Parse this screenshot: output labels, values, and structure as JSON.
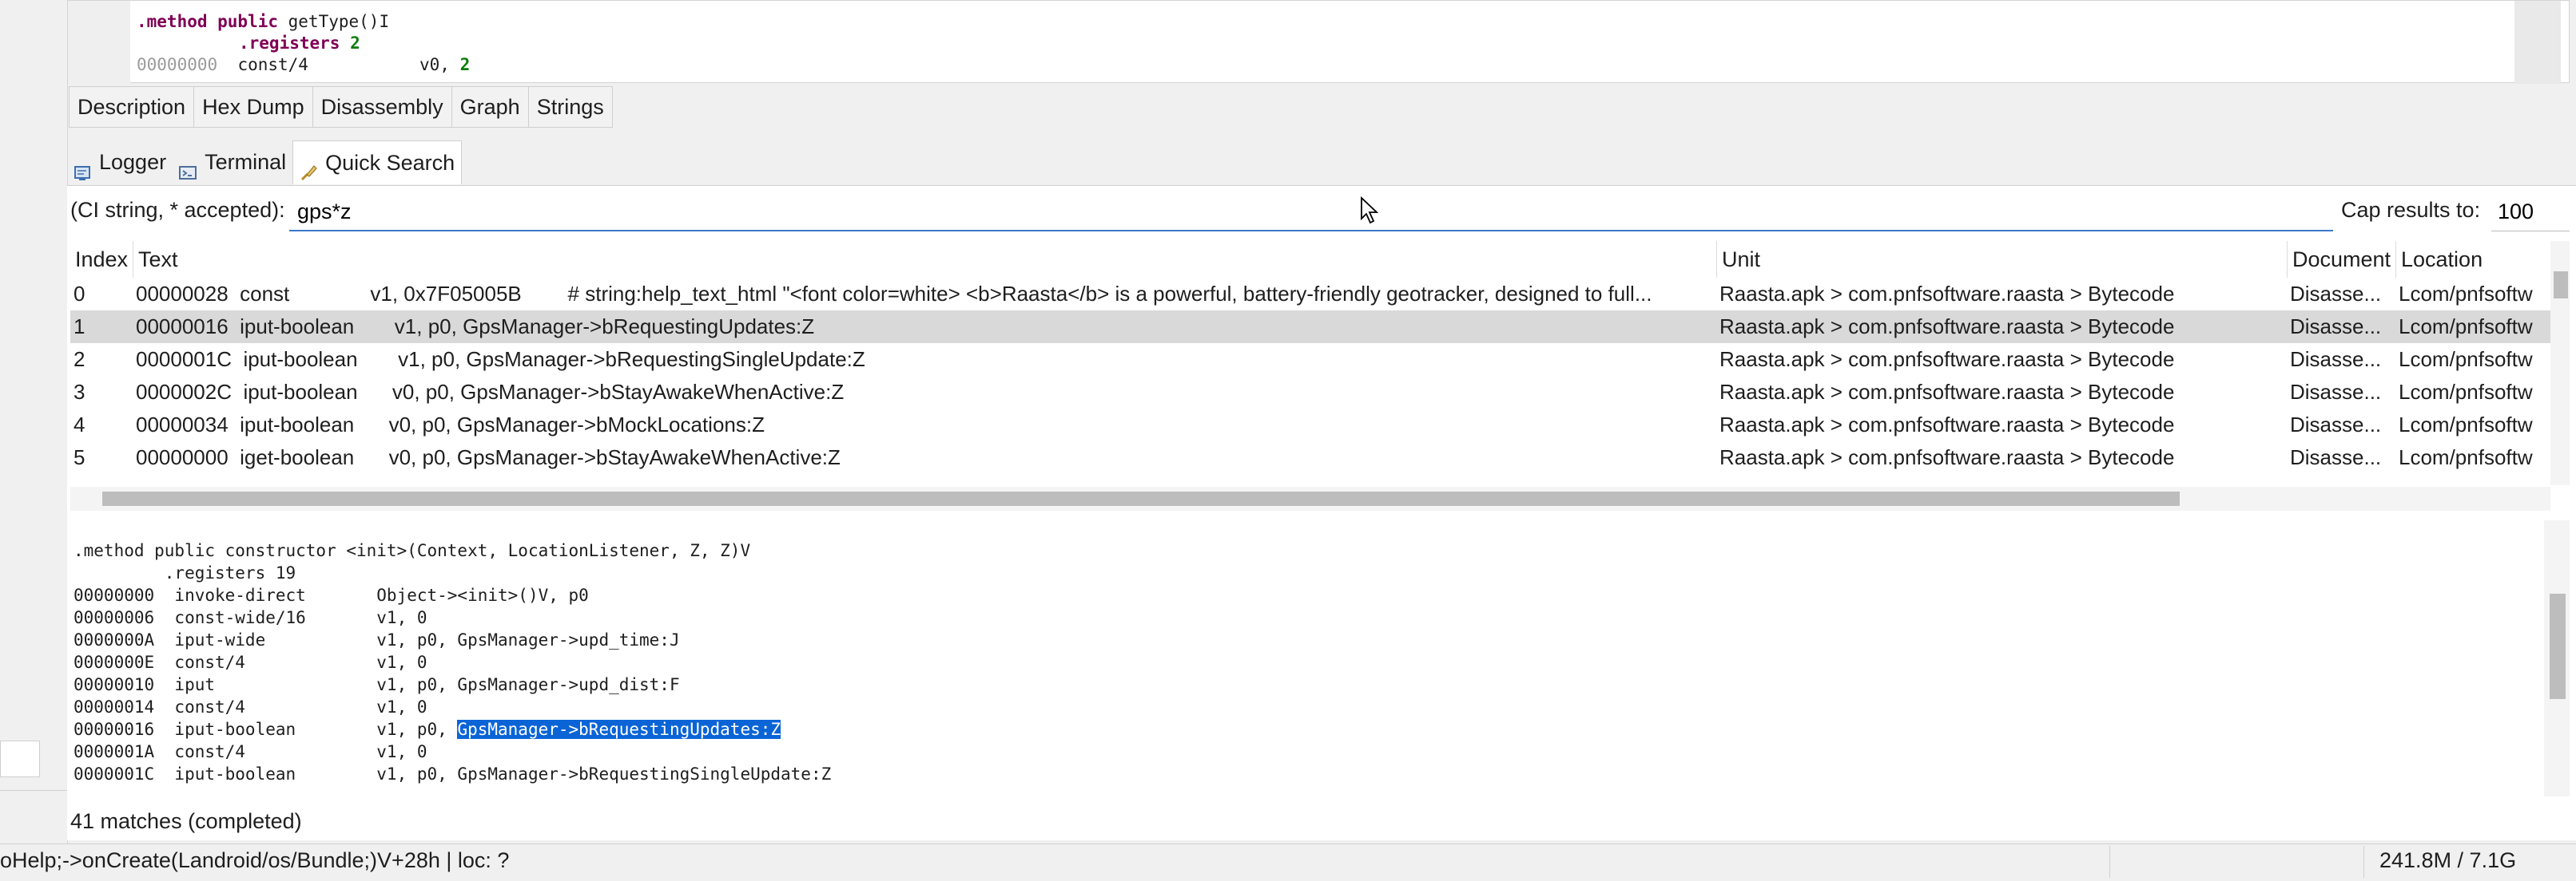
{
  "top_code": {
    "line1_kw": ".method public ",
    "line1_rest": "getType()I",
    "line2_kw": ".registers",
    "line2_num": " 2",
    "line3_addr": "00000000",
    "line3_instr": "  const/4           v0, ",
    "line3_num": "2"
  },
  "view_tabs": [
    "Description",
    "Hex Dump",
    "Disassembly",
    "Graph",
    "Strings"
  ],
  "panel_tabs": [
    {
      "label": "Logger",
      "icon": "logger-icon"
    },
    {
      "label": "Terminal",
      "icon": "terminal-icon"
    },
    {
      "label": "Quick Search",
      "icon": "quick-search-icon"
    }
  ],
  "search": {
    "label": "(CI string, * accepted):",
    "value": "gps*z",
    "cap_label": "Cap results to:",
    "cap_value": "100"
  },
  "results": {
    "columns": [
      "Index",
      "Text",
      "Unit",
      "Document",
      "Location"
    ],
    "rows": [
      {
        "index": "0",
        "text": "00000028  const              v1, 0x7F05005B        # string:help_text_html \"<font color=white> <b>Raasta</b> is a powerful, battery-friendly geotracker, designed to full...",
        "unit": "Raasta.apk > com.pnfsoftware.raasta > Bytecode",
        "document": "Disasse...",
        "location": "Lcom/pnfsoftw"
      },
      {
        "index": "1",
        "text": "00000016  iput-boolean       v1, p0, GpsManager->bRequestingUpdates:Z",
        "unit": "Raasta.apk > com.pnfsoftware.raasta > Bytecode",
        "document": "Disasse...",
        "location": "Lcom/pnfsoftw"
      },
      {
        "index": "2",
        "text": "0000001C  iput-boolean       v1, p0, GpsManager->bRequestingSingleUpdate:Z",
        "unit": "Raasta.apk > com.pnfsoftware.raasta > Bytecode",
        "document": "Disasse...",
        "location": "Lcom/pnfsoftw"
      },
      {
        "index": "3",
        "text": "0000002C  iput-boolean      v0, p0, GpsManager->bStayAwakeWhenActive:Z",
        "unit": "Raasta.apk > com.pnfsoftware.raasta > Bytecode",
        "document": "Disasse...",
        "location": "Lcom/pnfsoftw"
      },
      {
        "index": "4",
        "text": "00000034  iput-boolean      v0, p0, GpsManager->bMockLocations:Z",
        "unit": "Raasta.apk > com.pnfsoftware.raasta > Bytecode",
        "document": "Disasse...",
        "location": "Lcom/pnfsoftw"
      },
      {
        "index": "5",
        "text": "00000000  iget-boolean      v0, p0, GpsManager->bStayAwakeWhenActive:Z",
        "unit": "Raasta.apk > com.pnfsoftware.raasta > Bytecode",
        "document": "Disasse...",
        "location": "Lcom/pnfsoftw"
      }
    ]
  },
  "bottom_code": {
    "lines": [
      ".method public constructor <init>(Context, LocationListener, Z, Z)V",
      "         .registers 19",
      "00000000  invoke-direct       Object-><init>()V, p0",
      "00000006  const-wide/16       v1, 0",
      "0000000A  iput-wide           v1, p0, GpsManager->upd_time:J",
      "0000000E  const/4             v1, 0",
      "00000010  iput                v1, p0, GpsManager->upd_dist:F",
      "00000014  const/4             v1, 0",
      "00000016  iput-boolean        v1, p0, ",
      "0000001A  const/4             v1, 0",
      "0000001C  iput-boolean        v1, p0, GpsManager->bRequestingSingleUpdate:Z"
    ],
    "highlight": "GpsManager->bRequestingUpdates:Z"
  },
  "match_status": "41 matches (completed)",
  "status_bar": {
    "left": "oHelp;->onCreate(Landroid/os/Bundle;)V+28h | loc: ?",
    "memory": "241.8M / 7.1G"
  },
  "colors": {
    "selection_row": "#d9d9d9",
    "highlight": "#0a64d6",
    "keyword": "#7f0055"
  }
}
